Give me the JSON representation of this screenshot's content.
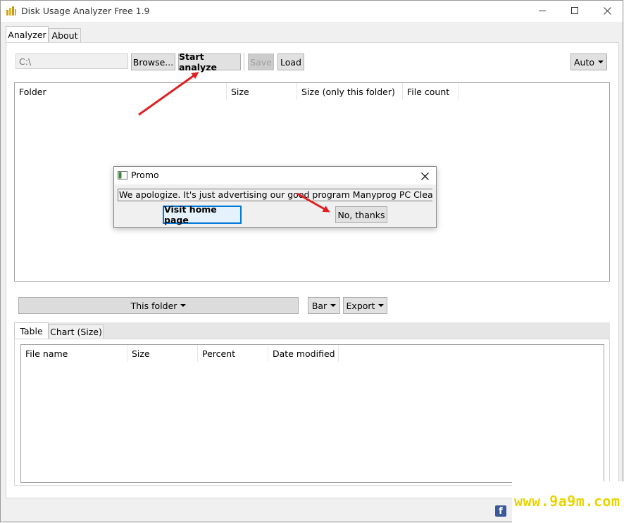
{
  "window": {
    "title": "Disk Usage Analyzer Free 1.9",
    "controls": {
      "minimize": "—",
      "maximize": "☐",
      "close": "✕"
    }
  },
  "main_tabs": [
    {
      "label": "Analyzer",
      "active": true
    },
    {
      "label": "About",
      "active": false
    }
  ],
  "toolbar": {
    "path_value": "C:\\",
    "browse_label": "Browse...",
    "start_label": "Start analyze",
    "save_label": "Save",
    "load_label": "Load",
    "auto_label": "Auto"
  },
  "folder_table": {
    "columns": [
      "Folder",
      "Size",
      "Size (only this folder)",
      "File count"
    ]
  },
  "promo": {
    "title": "Promo",
    "message": "We apologize. It's just advertising our good program Manyprog PC Cleaner",
    "visit_label": "Visit home page",
    "no_label": "No, thanks"
  },
  "midbar": {
    "folder_dropdown": "This folder",
    "bar_label": "Bar",
    "export_label": "Export"
  },
  "lower_tabs": [
    {
      "label": "Table",
      "active": true
    },
    {
      "label": "Chart (Size)",
      "active": false
    }
  ],
  "file_table": {
    "columns": [
      "File name",
      "Size",
      "Percent",
      "Date modified"
    ]
  },
  "watermark": {
    "text": "www.9a9m.com"
  },
  "icons": {
    "facebook": "f"
  },
  "colors": {
    "accent_blue": "#0078d7",
    "arrow_red": "#e02020",
    "watermark": "#e8d400"
  }
}
